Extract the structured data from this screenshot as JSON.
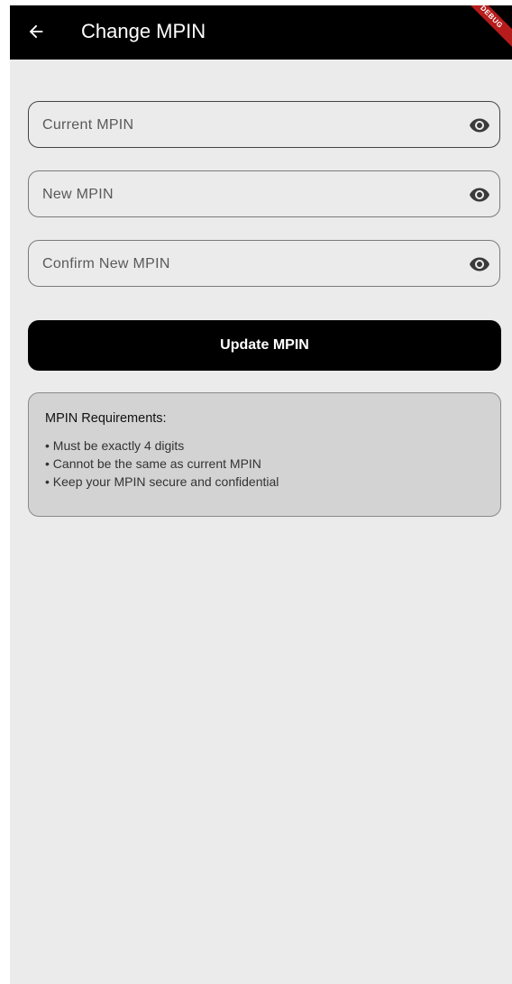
{
  "appbar": {
    "title": "Change MPIN",
    "debug_label": "DEBUG"
  },
  "fields": [
    {
      "placeholder": "Current MPIN",
      "value": ""
    },
    {
      "placeholder": "New MPIN",
      "value": ""
    },
    {
      "placeholder": "Confirm New MPIN",
      "value": ""
    }
  ],
  "icons": {
    "back": "arrow-left-icon",
    "visibility": "eye-icon"
  },
  "update_button": {
    "label": "Update MPIN"
  },
  "requirements": {
    "title": "MPIN Requirements:",
    "items": [
      "• Must be exactly 4 digits",
      "• Cannot be the same as current MPIN",
      "• Keep your MPIN secure and confidential"
    ]
  },
  "colors": {
    "appbar": "#000000",
    "background": "#ebebeb",
    "button": "#000000",
    "requirements_box": "#d3d3d3",
    "debug_banner": "#b71c1c"
  }
}
